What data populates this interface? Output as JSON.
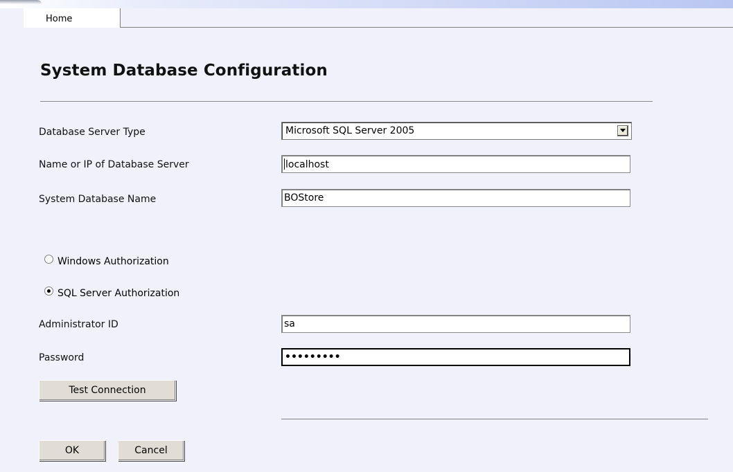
{
  "tabs": {
    "home_label": "Home"
  },
  "page": {
    "title": "System Database Configuration"
  },
  "form": {
    "server_type": {
      "label": "Database Server Type",
      "value": "Microsoft SQL Server 2005"
    },
    "server_name": {
      "label": "Name or IP of Database Server",
      "value": "localhost"
    },
    "db_name": {
      "label": "System Database Name",
      "value": "BOStore"
    },
    "auth": {
      "windows_label": "Windows Authorization",
      "sql_label": "SQL Server Authorization",
      "selected": "sql"
    },
    "admin_id": {
      "label": "Administrator ID",
      "value": "sa"
    },
    "password": {
      "label": "Password",
      "masked_value": "•••••••••"
    }
  },
  "buttons": {
    "test_connection": "Test Connection",
    "ok": "OK",
    "cancel": "Cancel"
  }
}
